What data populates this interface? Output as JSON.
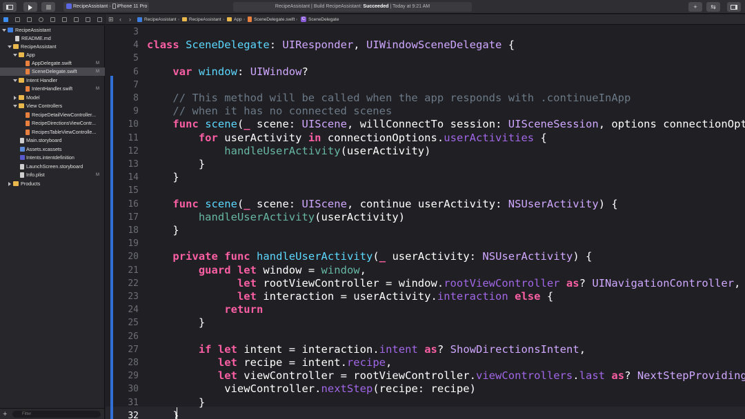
{
  "toolbar": {
    "scheme_app": "RecipeAssistant",
    "scheme_device": "iPhone 11 Pro",
    "status_prefix": "RecipeAssistant | Build RecipeAssistant:",
    "status_result": "Succeeded",
    "status_time": "| Today at 9:21 AM"
  },
  "jumpbar": {
    "crumbs": [
      "RecipeAssistant",
      "RecipeAssistant",
      "App",
      "SceneDelegate.swift",
      "SceneDelegate"
    ]
  },
  "sidebar": {
    "items": [
      {
        "label": "RecipeAssistant",
        "badge": ""
      },
      {
        "label": "README.md",
        "badge": ""
      },
      {
        "label": "RecipeAssistant",
        "badge": ""
      },
      {
        "label": "App",
        "badge": ""
      },
      {
        "label": "AppDelegate.swift",
        "badge": "M"
      },
      {
        "label": "SceneDelegate.swift",
        "badge": "M"
      },
      {
        "label": "Intent Handler",
        "badge": ""
      },
      {
        "label": "IntentHandler.swift",
        "badge": "M"
      },
      {
        "label": "Model",
        "badge": ""
      },
      {
        "label": "View Controllers",
        "badge": ""
      },
      {
        "label": "RecipeDetailViewController...",
        "badge": ""
      },
      {
        "label": "RecipeDirectionsViewContr...",
        "badge": ""
      },
      {
        "label": "RecipesTableViewControlle...",
        "badge": ""
      },
      {
        "label": "Main.storyboard",
        "badge": ""
      },
      {
        "label": "Assets.xcassets",
        "badge": ""
      },
      {
        "label": "Intents.intentdefinition",
        "badge": ""
      },
      {
        "label": "LaunchScreen.storyboard",
        "badge": ""
      },
      {
        "label": "Info.plist",
        "badge": "M"
      },
      {
        "label": "Products",
        "badge": ""
      }
    ],
    "filter_placeholder": "Filter"
  },
  "editor": {
    "line_numbers": [
      "3",
      "4",
      "5",
      "6",
      "7",
      "8",
      "9",
      "10",
      "11",
      "12",
      "13",
      "14",
      "15",
      "16",
      "17",
      "18",
      "19",
      "20",
      "21",
      "22",
      "23",
      "24",
      "25",
      "26",
      "27",
      "28",
      "29",
      "30",
      "31",
      "32"
    ],
    "lines": [
      "",
      "class SceneDelegate: UIResponder, UIWindowSceneDelegate {",
      "",
      "    var window: UIWindow?",
      "",
      "    // This method will be called when the app responds with .continueInApp",
      "    // when it has no connected scenes",
      "    func scene(_ scene: UIScene, willConnectTo session: UISceneSession, options connectionOptions: UIScene.ConnectionOptions) {",
      "        for userActivity in connectionOptions.userActivities {",
      "            handleUserActivity(userActivity)",
      "        }",
      "    }",
      "",
      "    func scene(_ scene: UIScene, continue userActivity: NSUserActivity) {",
      "        handleUserActivity(userActivity)",
      "    }",
      "",
      "    private func handleUserActivity(_ userActivity: NSUserActivity) {",
      "        guard let window = window,",
      "              let rootViewController = window.rootViewController as? UINavigationController,",
      "              let interaction = userActivity.interaction else {",
      "            return",
      "        }",
      "",
      "        if let intent = interaction.intent as? ShowDirectionsIntent,",
      "           let recipe = intent.recipe,",
      "           let viewController = rootViewController.viewControllers.last as? NextStepProviding {",
      "            viewController.nextStep(recipe: recipe)",
      "        }",
      "    }"
    ]
  }
}
